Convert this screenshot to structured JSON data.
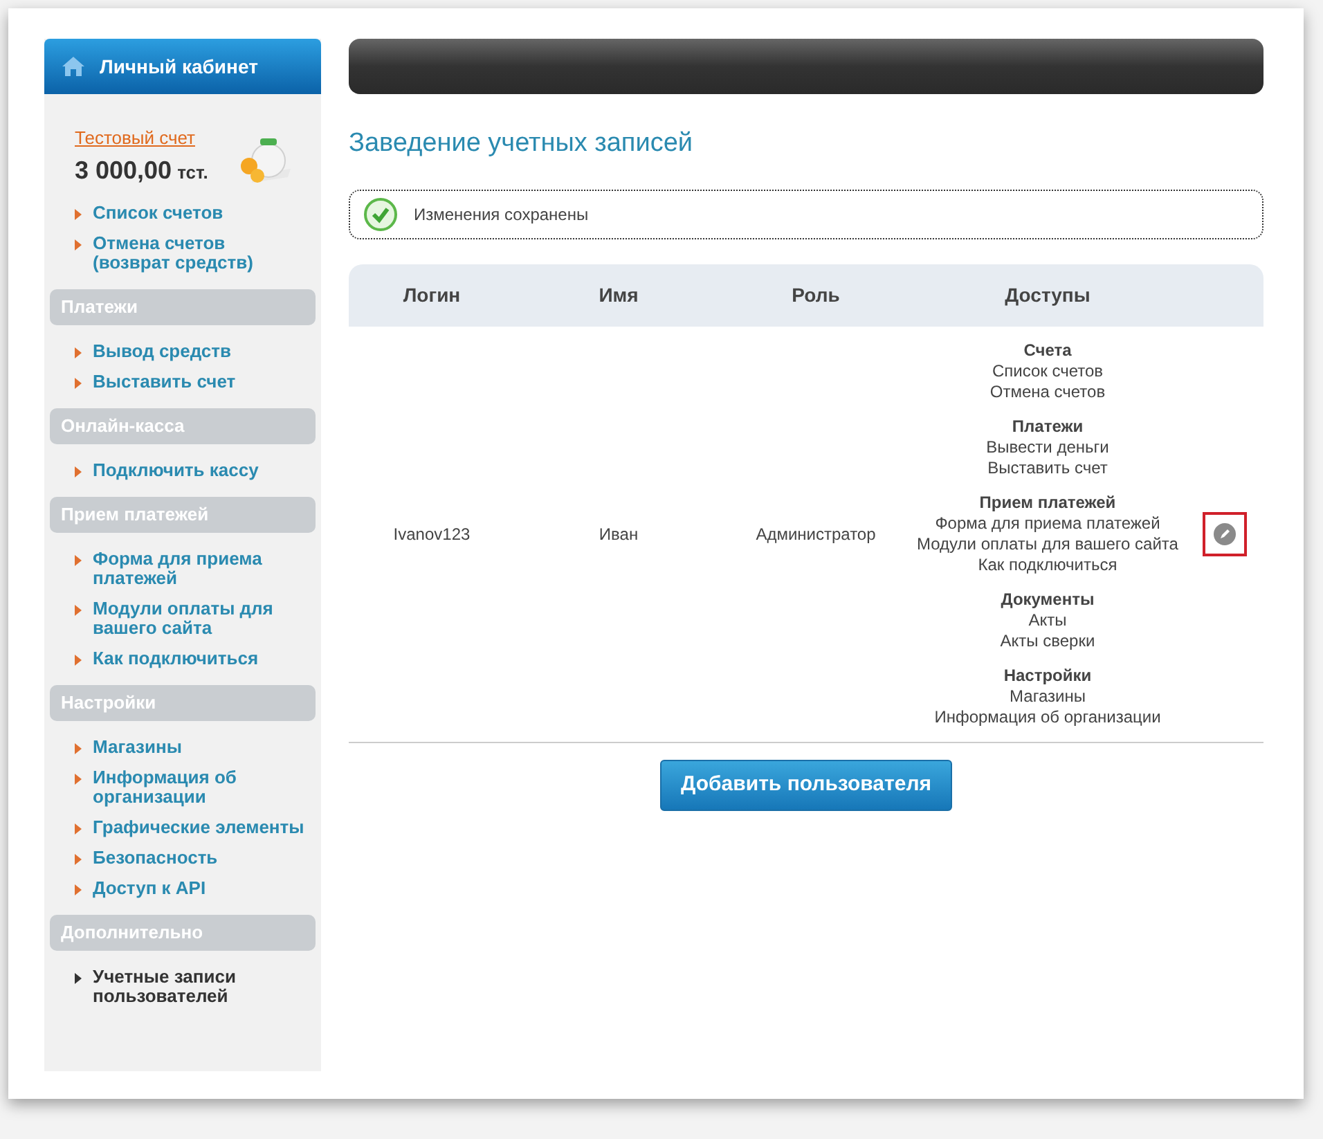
{
  "sidebar": {
    "header": "Личный кабинет",
    "account": {
      "link": "Тестовый счет",
      "balance": "3 000,00",
      "currency": "тст."
    },
    "top_items": [
      {
        "label": "Список счетов",
        "selected": false
      },
      {
        "label": "Отмена счетов (возврат средств)",
        "selected": false
      }
    ],
    "groups": [
      {
        "title": "Платежи",
        "items": [
          {
            "label": "Вывод средств",
            "selected": false
          },
          {
            "label": "Выставить счет",
            "selected": false
          }
        ]
      },
      {
        "title": "Онлайн-касса",
        "items": [
          {
            "label": "Подключить кассу",
            "selected": false
          }
        ]
      },
      {
        "title": "Прием платежей",
        "items": [
          {
            "label": "Форма для приема платежей",
            "selected": false
          },
          {
            "label": "Модули оплаты для вашего сайта",
            "selected": false
          },
          {
            "label": "Как подключиться",
            "selected": false
          }
        ]
      },
      {
        "title": "Настройки",
        "items": [
          {
            "label": "Магазины",
            "selected": false
          },
          {
            "label": "Информация об организации",
            "selected": false
          },
          {
            "label": "Графические элементы",
            "selected": false
          },
          {
            "label": "Безопасность",
            "selected": false
          },
          {
            "label": "Доступ к API",
            "selected": false
          }
        ]
      },
      {
        "title": "Дополнительно",
        "items": [
          {
            "label": "Учетные записи пользователей",
            "selected": true
          }
        ]
      }
    ]
  },
  "page_title": "Заведение учетных записей",
  "notice": "Изменения сохранены",
  "table": {
    "columns": [
      "Логин",
      "Имя",
      "Роль",
      "Доступы"
    ],
    "rows": [
      {
        "login": "Ivanov123",
        "name": "Иван",
        "role": "Администратор",
        "edit_highlighted": true,
        "access": [
          {
            "title": "Счета",
            "items": [
              "Список счетов",
              "Отмена счетов"
            ]
          },
          {
            "title": "Платежи",
            "items": [
              "Вывести деньги",
              "Выставить счет"
            ]
          },
          {
            "title": "Прием платежей",
            "items": [
              "Форма для приема платежей",
              "Модули оплаты для вашего сайта",
              "Как подключиться"
            ]
          },
          {
            "title": "Документы",
            "items": [
              "Акты",
              "Акты сверки"
            ]
          },
          {
            "title": "Настройки",
            "items": [
              "Магазины",
              "Информация об организации"
            ]
          }
        ]
      }
    ]
  },
  "add_button": "Добавить пользователя"
}
